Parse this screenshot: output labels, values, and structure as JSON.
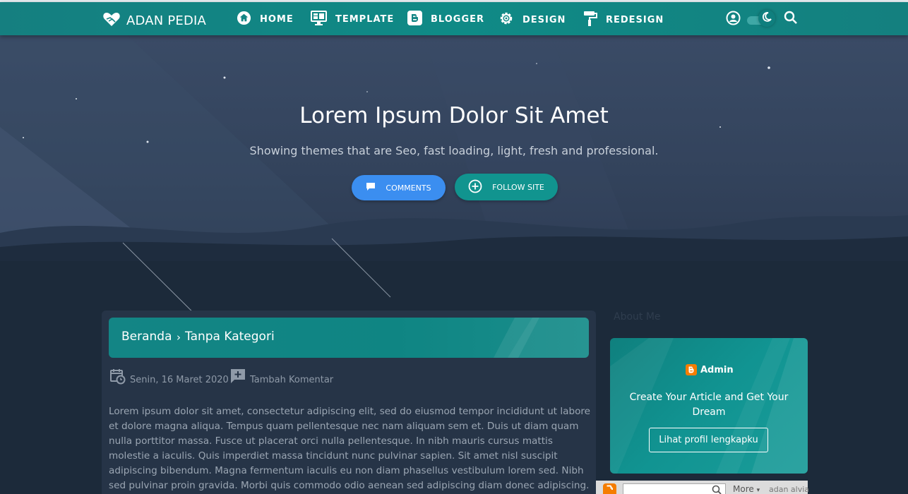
{
  "nav": {
    "brand": "ADAN PEDIA",
    "items": [
      {
        "label": "HOME",
        "icon": "home-icon"
      },
      {
        "label": "TEMPLATE",
        "icon": "monitor-icon"
      },
      {
        "label": "BLOGGER",
        "icon": "blogger-icon"
      },
      {
        "label": "DESIGN",
        "icon": "gear-icon"
      },
      {
        "label": "REDESIGN",
        "icon": "paint-roller-icon"
      }
    ],
    "right_icons": [
      "user-icon",
      "dark-mode-toggle",
      "search-icon"
    ]
  },
  "hero": {
    "title": "Lorem Ipsum Dolor Sit Amet",
    "subtitle": "Showing themes that are Seo, fast loading, light, fresh and professional.",
    "comments_button": "COMMENTS",
    "follow_button": "FOLLOW SITE"
  },
  "breadcrumb": {
    "home": "Beranda",
    "separator": "›",
    "category": "Tanpa Kategori"
  },
  "meta": {
    "date": "Senin, 16 Maret 2020",
    "comment": "Tambah Komentar"
  },
  "post": {
    "body": "Lorem ipsum dolor sit amet, consectetur adipiscing elit, sed do eiusmod tempor incididunt ut labore et dolore magna aliqua. Tempus quam pellentesque nec nam aliquam sem et. Duis ut diam quam nulla porttitor massa. Fusce ut placerat orci nulla pellentesque. In nibh mauris cursus mattis molestie a iaculis. Quis imperdiet massa tincidunt nunc pulvinar sapien. Sit amet nisl suscipit adipiscing bibendum. Magna fermentum iaculis eu non diam phasellus vestibulum lorem sed. Nibh sed pulvinar proin gravida. Morbi quis commodo odio aenean sed adipiscing diam donec adipiscing."
  },
  "sidebar": {
    "about_title": "About Me",
    "admin_name": "Admin",
    "description": "Create Your Article and Get Your Dream",
    "profile_button": "Lihat profil lengkapku"
  },
  "blogger_bar": {
    "more": "More",
    "user": "adan alvia"
  },
  "colors": {
    "nav": "#138584",
    "hero": "#374863",
    "page_bg": "#1c2a3a",
    "comments_btn": "#3b8ef0",
    "follow_btn": "#11948f"
  }
}
